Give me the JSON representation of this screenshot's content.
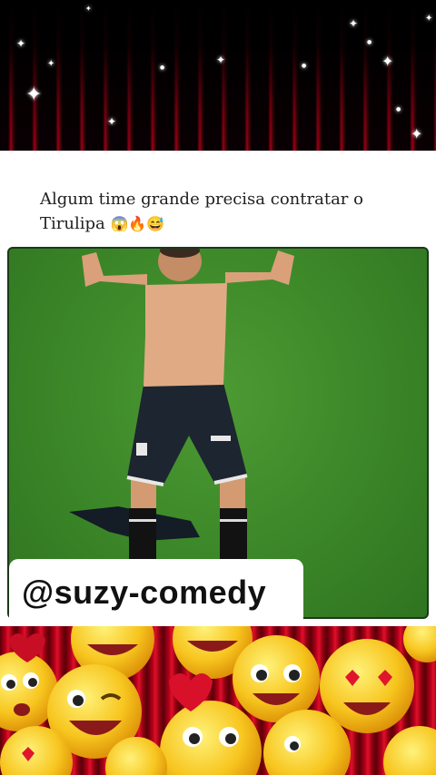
{
  "post": {
    "caption_line1": "Algum time grande precisa contratar o",
    "caption_line2": "Tirulipa",
    "caption_emojis": "😱🔥😅"
  },
  "watermark": {
    "text": "@suzy-comedy"
  },
  "video": {
    "content": "shirtless soccer player celebrating on pitch"
  },
  "colors": {
    "card_bg": "#ffffff",
    "pitch_green": "#3e8a2a",
    "banner_red": "#c3001a"
  }
}
